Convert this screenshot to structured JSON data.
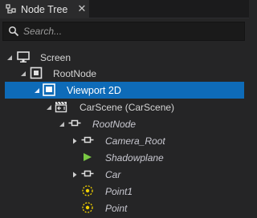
{
  "panel": {
    "tab_label": "Node Tree",
    "close_glyph": "✕"
  },
  "search": {
    "placeholder": "Search..."
  },
  "tree": {
    "items": [
      {
        "label": "Screen",
        "icon": "monitor-icon",
        "expanded": true
      },
      {
        "label": "RootNode",
        "icon": "square-node-icon",
        "expanded": true
      },
      {
        "label": "Viewport 2D",
        "icon": "viewport-icon",
        "expanded": true,
        "selected": true
      },
      {
        "label": "CarScene (CarScene)",
        "icon": "scene-icon",
        "expanded": true
      },
      {
        "label": "RootNode",
        "icon": "node-icon",
        "expanded": true
      },
      {
        "label": "Camera_Root",
        "icon": "node-icon",
        "expanded": false
      },
      {
        "label": "Shadowplane",
        "icon": "shadowplane-icon",
        "expanded": false
      },
      {
        "label": "Car",
        "icon": "node-icon",
        "expanded": false
      },
      {
        "label": "Point1",
        "icon": "light-icon",
        "expanded": false
      },
      {
        "label": "Point",
        "icon": "light-icon",
        "expanded": false
      }
    ]
  },
  "colors": {
    "selection": "#0e6bb8",
    "background": "#252526",
    "light_icon": "#f0d000",
    "shadowplane_icon": "#7ac943"
  }
}
